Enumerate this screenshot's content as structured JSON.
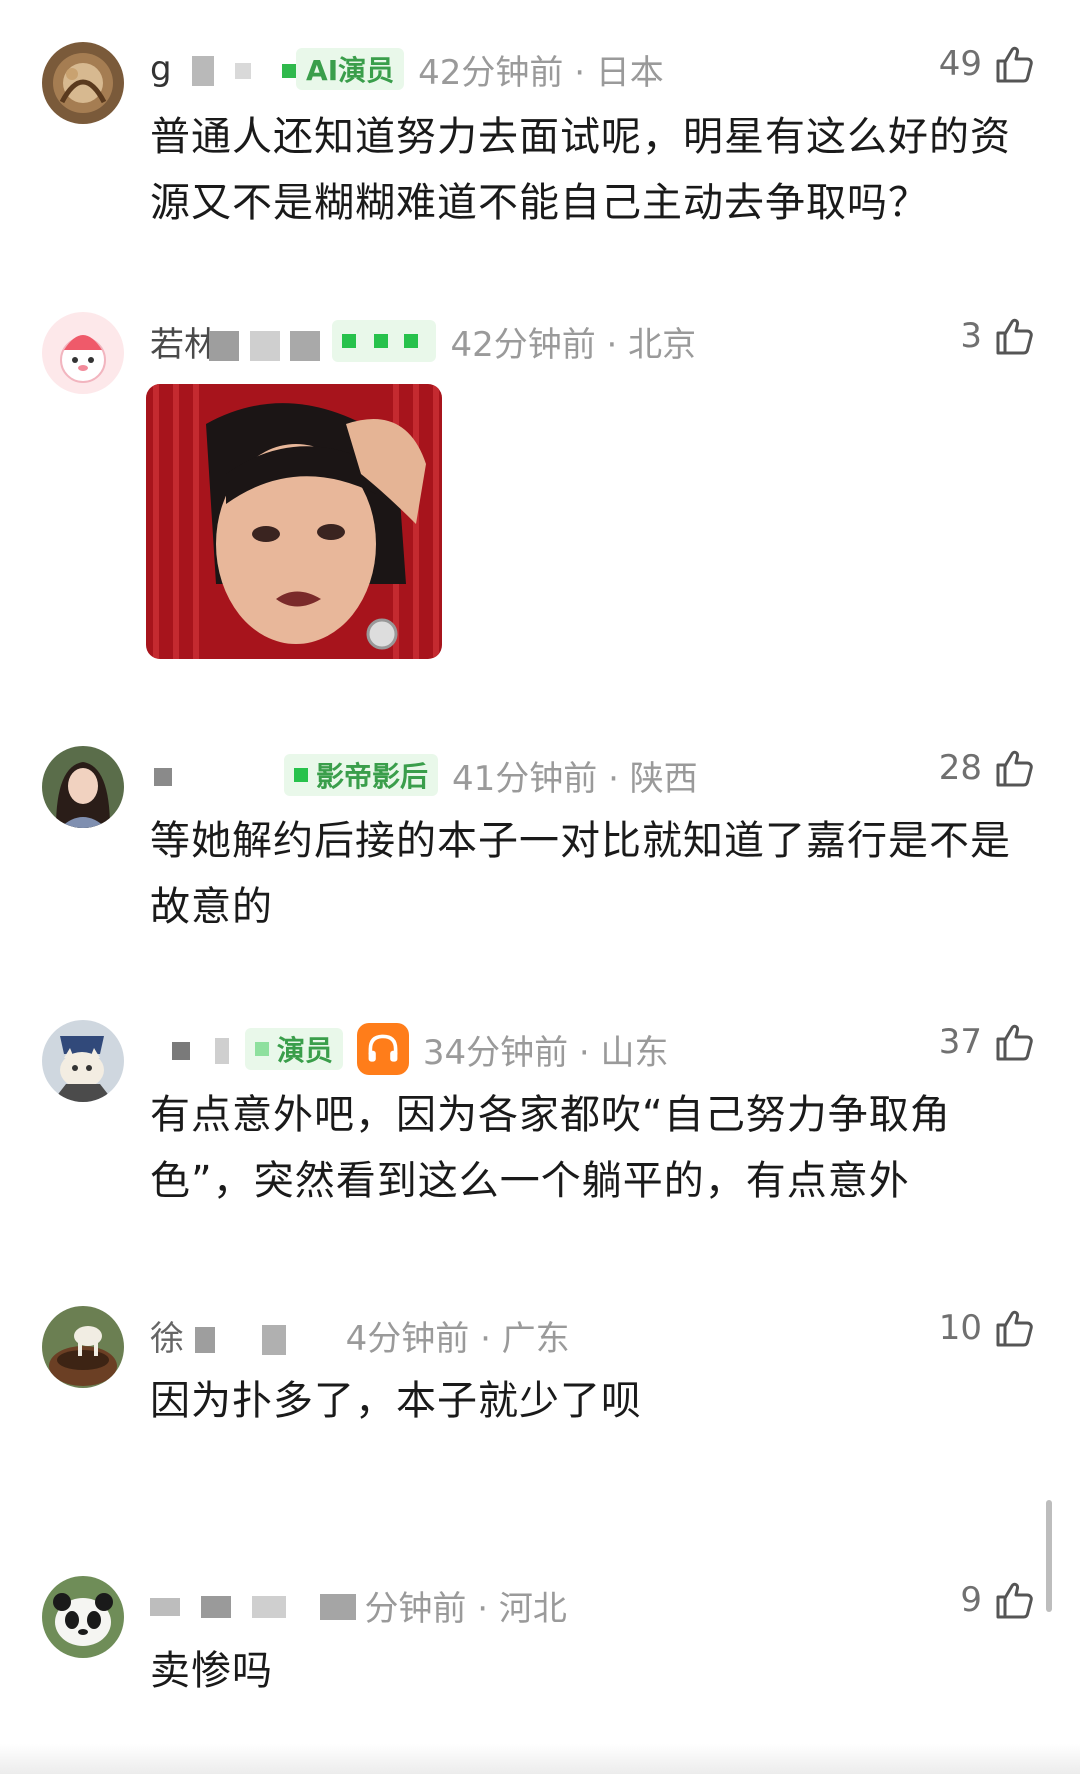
{
  "comments": [
    {
      "user_fragment": "g",
      "badge": "AI演员",
      "time_location": "42分钟前 · 日本",
      "likes": "49",
      "text": "普通人还知道努力去面试呢，明星有这么好的资源又不是糊糊难道不能自己主动去争取吗？",
      "avatar_icon": "ornate-art-avatar"
    },
    {
      "user_fragment": "若林",
      "badge": "",
      "time_location": "42分钟前 · 北京",
      "likes": "3",
      "text": "",
      "image_icon": "meme-woman-hand-on-head",
      "avatar_icon": "strawberry-cartoon-avatar"
    },
    {
      "user_fragment": "",
      "badge": "影帝影后",
      "time_location": "41分钟前 · 陕西",
      "likes": "28",
      "text": "等她解约后接的本子一对比就知道了嘉行是不是故意的",
      "avatar_icon": "girl-portrait-avatar"
    },
    {
      "user_fragment": "",
      "badge": "演员",
      "time_location": "34分钟前 · 山东",
      "likes": "37",
      "text": "有点意外吧，因为各家都吹“自己努力争取角色”，突然看到这么一个躺平的，有点意外",
      "avatar_icon": "cat-avatar",
      "extra_icon": "headphones-icon"
    },
    {
      "user_fragment": "徐",
      "badge": "",
      "time_location": "4分钟前 · 广东",
      "likes": "10",
      "text": "因为扑多了，本子就少了呗",
      "avatar_icon": "goat-avatar"
    },
    {
      "user_fragment": "",
      "badge": "",
      "time_location": "分钟前 · 河北",
      "likes": "9",
      "text": "卖惨吗",
      "avatar_icon": "panda-avatar"
    }
  ],
  "colors": {
    "badge_bg": "#e9f8ea",
    "badge_text": "#3a9e4b",
    "meta_gray": "#9a9a9a",
    "music_orange": "#ff7d1a"
  }
}
